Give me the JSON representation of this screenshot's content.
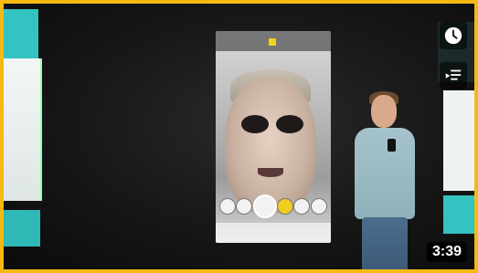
{
  "video": {
    "duration": "3:39"
  },
  "overlay": {
    "watch_later_icon": "clock-icon",
    "add_to_queue_icon": "queue-icon"
  },
  "colors": {
    "border": "#f5b914",
    "accent_teal": "#33c3c0"
  }
}
